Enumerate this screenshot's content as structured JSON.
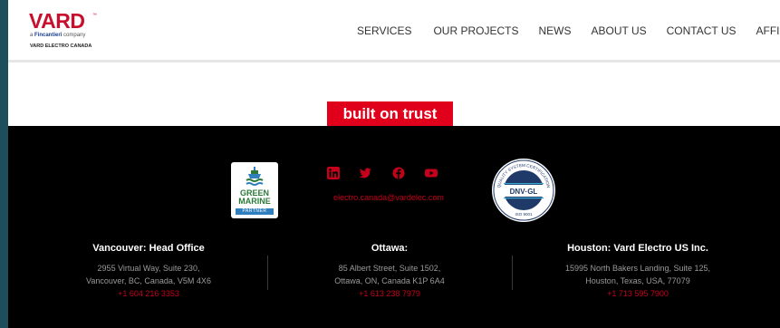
{
  "header": {
    "logo": {
      "word": "VARD",
      "tm": "™",
      "company_prefix": "a ",
      "company_name": "Fincantieri",
      "company_suffix": " company",
      "unit": "VARD ELECTRO CANADA"
    },
    "nav": [
      "SERVICES",
      "OUR PROJECTS",
      "NEWS",
      "ABOUT US",
      "CONTACT US",
      "AFFILIATES"
    ]
  },
  "tagline": "built on trust",
  "footer": {
    "green_marine": {
      "line1": "GREEN",
      "line2": "MARINE",
      "line3": "PARTNER"
    },
    "socials": [
      "linkedin-icon",
      "twitter-icon",
      "facebook-icon",
      "youtube-icon"
    ],
    "email": "electro.canada@vardelec.com",
    "dnv": {
      "arc_text": "QUALITY SYSTEM CERTIFICATION",
      "brand": "DNV·GL",
      "standard": "ISO 9001"
    },
    "offices": [
      {
        "title": "Vancouver: Head Office",
        "line1": "2955 Virtual Way, Suite 230,",
        "line2": "Vancouver, BC, Canada, V5M 4X6",
        "phone": "+1 604 216 3353"
      },
      {
        "title": "Ottawa:",
        "line1": "85 Albert Street, Suite 1502,",
        "line2": "Ottawa, ON, Canada K1P 6A4",
        "phone": "+1 613 238 7979"
      },
      {
        "title": "Houston: Vard Electro US Inc.",
        "line1": "15995 North Bakers Landing, Suite 125,",
        "line2": "Houston, Texas, USA, 77079",
        "phone": "+1 713 595 7900"
      }
    ]
  },
  "colors": {
    "brand_red": "#e0001b",
    "footer_bg": "#000000",
    "link_red": "#c4001a"
  }
}
